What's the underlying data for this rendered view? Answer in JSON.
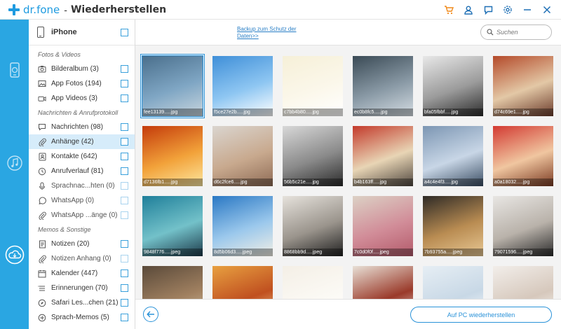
{
  "app": {
    "brand": "dr.fone",
    "separator": "-",
    "title": "Wiederherstellen",
    "window_icons": [
      "cart-icon",
      "user-icon",
      "feedback-icon",
      "settings-icon",
      "minimize-icon",
      "close-icon"
    ]
  },
  "strip": {
    "buttons": [
      "phone-recover-icon",
      "music-icon",
      "cloud-restore-icon"
    ],
    "active": "cloud-restore-icon"
  },
  "sidebar": {
    "device": "iPhone",
    "groups": [
      {
        "title": "Fotos & Videos",
        "items": [
          {
            "label": "Bilderalbum (3)",
            "icon": "camera-icon",
            "enabled": true
          },
          {
            "label": "App Fotos (194)",
            "icon": "image-icon",
            "enabled": true
          },
          {
            "label": "App Videos (3)",
            "icon": "video-icon",
            "enabled": true
          }
        ]
      },
      {
        "title": "Nachrichten & Anrufprotokoll",
        "items": [
          {
            "label": "Nachrichten (98)",
            "icon": "message-icon",
            "enabled": true
          },
          {
            "label": "Anhänge (42)",
            "icon": "paperclip-icon",
            "enabled": true,
            "selected": true
          },
          {
            "label": "Kontakte (642)",
            "icon": "contacts-icon",
            "enabled": true
          },
          {
            "label": "Anrufverlauf (81)",
            "icon": "clock-icon",
            "enabled": true
          },
          {
            "label": "Sprachnac...hten (0)",
            "icon": "microphone-icon",
            "enabled": false
          },
          {
            "label": "WhatsApp (0)",
            "icon": "whatsapp-icon",
            "enabled": false
          },
          {
            "label": "WhatsApp ...änge (0)",
            "icon": "paperclip-icon",
            "enabled": false
          }
        ]
      },
      {
        "title": "Memos & Sonstige",
        "items": [
          {
            "label": "Notizen (20)",
            "icon": "notes-icon",
            "enabled": true
          },
          {
            "label": "Notizen Anhang (0)",
            "icon": "paperclip-icon",
            "enabled": false
          },
          {
            "label": "Kalender (447)",
            "icon": "calendar-icon",
            "enabled": true
          },
          {
            "label": "Erinnerungen (70)",
            "icon": "reminder-icon",
            "enabled": true
          },
          {
            "label": "Safari Les...chen (21)",
            "icon": "compass-icon",
            "enabled": true
          },
          {
            "label": "Sprach-Memos (5)",
            "icon": "voice-memo-icon",
            "enabled": true
          }
        ]
      }
    ]
  },
  "topbar": {
    "backup_link": "Backup zum Schutz der Daten>>",
    "search_placeholder": "Suchen"
  },
  "thumbnails": [
    {
      "caption": "fee13139.....jpg",
      "selected": true,
      "palette": [
        "#4a6f8c",
        "#7fa6c4",
        "#c9d6de"
      ]
    },
    {
      "caption": "f5ce27e2b.....jpg",
      "palette": [
        "#3f8fd8",
        "#8ec6f2",
        "#ffffff"
      ]
    },
    {
      "caption": "c7bb4b80.....jpg",
      "palette": [
        "#f6f0d8",
        "#fbf7ea",
        "#ffffff"
      ]
    },
    {
      "caption": "ec0b8fc5.....jpg",
      "palette": [
        "#3a4a55",
        "#8a9aa6",
        "#d5dde3"
      ]
    },
    {
      "caption": "bfa05fbbf.....jpg",
      "palette": [
        "#e8e8e8",
        "#9b9b9b",
        "#2b2b2b"
      ]
    },
    {
      "caption": "d74c69e1.....jpg",
      "palette": [
        "#b44a2a",
        "#e3c8a6",
        "#6b3b2b"
      ]
    },
    {
      "caption": "d7136fb1.....jpg",
      "palette": [
        "#c43b0b",
        "#f2a23a",
        "#fde7a0"
      ]
    },
    {
      "caption": "d6c2fce6.....jpg",
      "palette": [
        "#dad5cf",
        "#c8a98e",
        "#8e6b55"
      ]
    },
    {
      "caption": "56b5c21e.....jpg",
      "palette": [
        "#d8d8d8",
        "#8a8a8a",
        "#2a2a2a"
      ]
    },
    {
      "caption": "b4b163ff.....jpg",
      "palette": [
        "#c33a2b",
        "#e8d5b5",
        "#50473f"
      ]
    },
    {
      "caption": "a4c4e4f3.....jpg",
      "palette": [
        "#7c96b3",
        "#c8d6e6",
        "#3a4d63"
      ]
    },
    {
      "caption": "a0a18032.....jpg",
      "palette": [
        "#d33a32",
        "#f0c6a0",
        "#7a3a22"
      ]
    },
    {
      "caption": "9848f776.....jpeg",
      "palette": [
        "#1f7f9a",
        "#73c1c9",
        "#1c3a4a"
      ]
    },
    {
      "caption": "8d5b06d3.....jpeg",
      "palette": [
        "#2a78c4",
        "#9bc8ec",
        "#f2efe5"
      ]
    },
    {
      "caption": "8868bb9d.....jpeg",
      "palette": [
        "#e6e2dc",
        "#9a948c",
        "#1f1f1f"
      ]
    },
    {
      "caption": "7c0d0f0f.....jpeg",
      "palette": [
        "#dcd1c5",
        "#d18c98",
        "#b35a6a"
      ]
    },
    {
      "caption": "7b93755a.....jpeg",
      "palette": [
        "#2e2a26",
        "#b98c52",
        "#e8c894"
      ]
    },
    {
      "caption": "79071596.....jpeg",
      "palette": [
        "#e8e6e3",
        "#b9b2aa",
        "#2a2a2a"
      ]
    },
    {
      "caption": "",
      "palette": [
        "#5a4a3a",
        "#a08060",
        "#d8c8a8"
      ]
    },
    {
      "caption": "",
      "palette": [
        "#e8a040",
        "#c05020",
        "#f6d8a0"
      ]
    },
    {
      "caption": "",
      "palette": [
        "#f4efe6",
        "#fbf9f4",
        "#ffffff"
      ]
    },
    {
      "caption": "",
      "palette": [
        "#e8e0d6",
        "#9a3a2a",
        "#f4f0ea"
      ]
    },
    {
      "caption": "",
      "palette": [
        "#e6eef4",
        "#c8d8e6",
        "#ffffff"
      ]
    },
    {
      "caption": "",
      "palette": [
        "#f2eeea",
        "#d6c8bc",
        "#ffffff"
      ]
    }
  ],
  "bottombar": {
    "restore_label": "Auf PC wiederherstellen"
  },
  "colors": {
    "accent": "#2a92d8",
    "strip": "#2aa6e2",
    "cart_icon": "#f08a1c",
    "selected_row": "#d6ecfa"
  }
}
